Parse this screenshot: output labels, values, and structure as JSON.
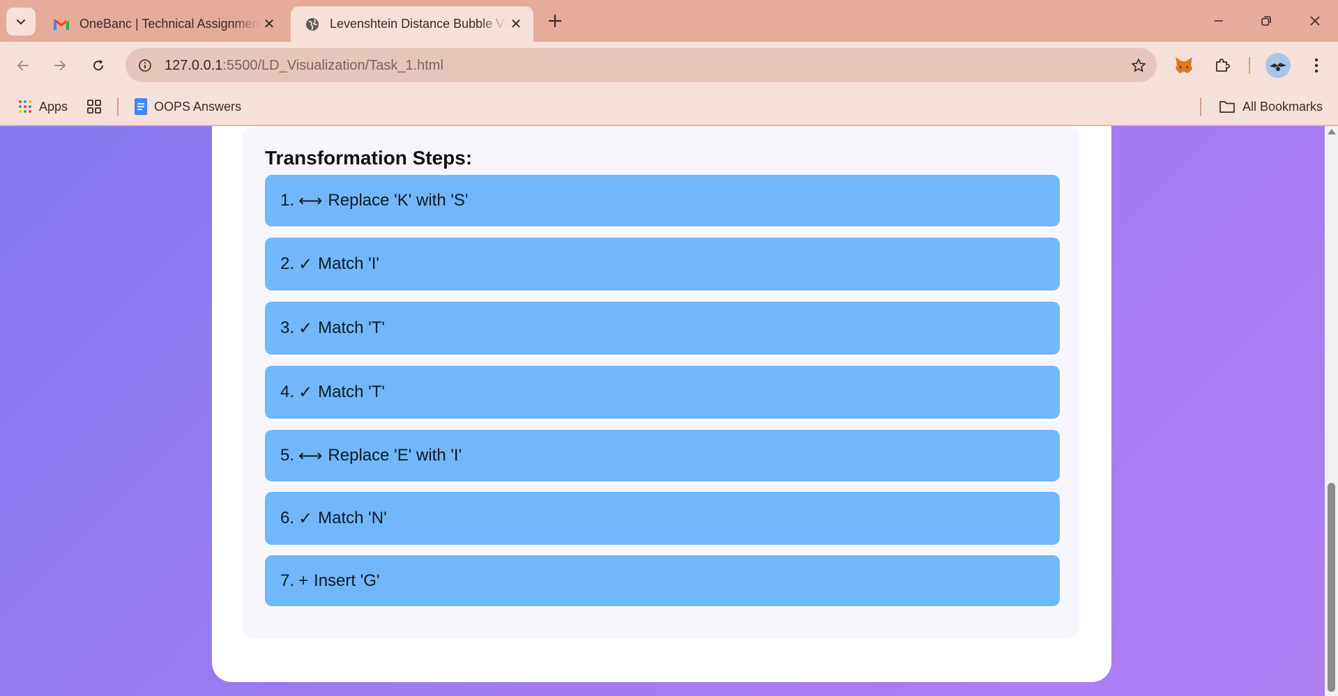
{
  "browser": {
    "tabs": [
      {
        "title": "OneBanc | Technical Assignment",
        "icon": "gmail-icon",
        "active": false
      },
      {
        "title": "Levenshtein Distance Bubble Visualization",
        "icon": "globe-icon",
        "active": true
      }
    ],
    "url_host": "127.0.0.1",
    "url_path": ":5500/LD_Visualization/Task_1.html",
    "bookmarks": {
      "apps_label": "Apps",
      "oops_label": "OOPS Answers",
      "all_label": "All Bookmarks"
    }
  },
  "page": {
    "steps_title": "Transformation Steps:",
    "steps": [
      {
        "number": "1.",
        "symbol": "⟷",
        "text": "Replace 'K' with 'S'"
      },
      {
        "number": "2.",
        "symbol": "✓",
        "text": "Match 'I'"
      },
      {
        "number": "3.",
        "symbol": "✓",
        "text": "Match 'T'"
      },
      {
        "number": "4.",
        "symbol": "✓",
        "text": "Match 'T'"
      },
      {
        "number": "5.",
        "symbol": "⟷",
        "text": "Replace 'E' with 'I'"
      },
      {
        "number": "6.",
        "symbol": "✓",
        "text": "Match 'N'"
      },
      {
        "number": "7.",
        "symbol": "+",
        "text": "Insert 'G'"
      }
    ]
  },
  "colors": {
    "step_background": "#72b7fc",
    "page_gradient_start": "#8578f0",
    "page_gradient_end": "#b07ff4",
    "browser_frame": "#e5ac9b"
  }
}
